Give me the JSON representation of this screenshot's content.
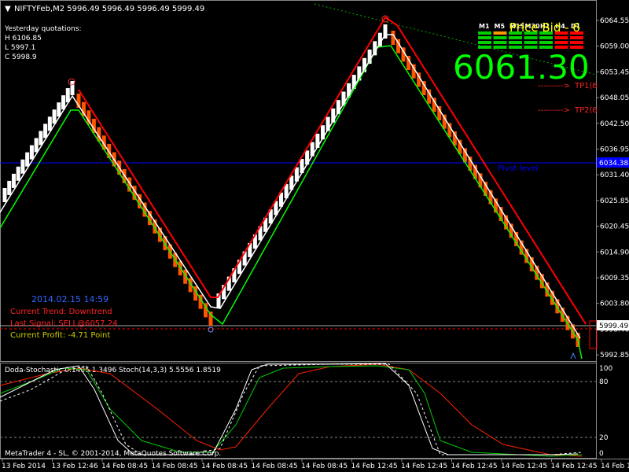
{
  "header": {
    "symbol_line": "NIFTYFeb,M2  5996.49 5996.49 5996.49 5999.49"
  },
  "yesterday": {
    "title": "Yesterday quotations:",
    "high": "H 6106.85",
    "low": "L 5997.1",
    "close": "C 5998.9"
  },
  "info": {
    "datetime": "2014.02.15 14:59",
    "trend": "Current Trend: Downtrend",
    "signal": "Last Signal: SELL@6057.24",
    "profit": "Current Profit: -4.71 Point"
  },
  "price_display": {
    "bid_label": "Price Bid - 6",
    "bid_value": "6061.30",
    "tp1": "TP1(6",
    "tp2": "TP2(6",
    "pivot_label": "Pivot level",
    "pivot_value": "6034.38"
  },
  "timeframes": [
    {
      "label": "M1",
      "bars": [
        "#00d000",
        "#00d000",
        "#00d000",
        "#00d000"
      ]
    },
    {
      "label": "M5",
      "bars": [
        "#ff9900",
        "#00d000",
        "#00d000",
        "#00d000"
      ]
    },
    {
      "label": "M15",
      "bars": [
        "#00d000",
        "#00d000",
        "#00d000",
        "#00d000"
      ]
    },
    {
      "label": "M30",
      "bars": [
        "#00d000",
        "#00d000",
        "#00d000",
        "#00d000"
      ]
    },
    {
      "label": "H1",
      "bars": [
        "#00d000",
        "#00d000",
        "#00d000",
        "#00d000"
      ]
    },
    {
      "label": "H4",
      "bars": [
        "#ff0000",
        "#ff0000",
        "#ff0000",
        "#ff0000"
      ]
    },
    {
      "label": "D1",
      "bars": [
        "#ff0000",
        "#ff0000",
        "#ff0000",
        "#ff0000"
      ]
    }
  ],
  "price_axis": {
    "ticks": [
      "6064.55",
      "6059.00",
      "6053.45",
      "6048.05",
      "6042.50",
      "6036.95",
      "6031.40",
      "6025.85",
      "6020.45",
      "6014.90",
      "6009.35",
      "6003.80",
      "5998.40",
      "5992.85"
    ],
    "current_price": "5999.49",
    "pivot_price": "6034.38"
  },
  "indicator": {
    "title": "Doda-Stochastic 0.1405 1.3496  Stoch(14,3,3) 5.5556 1.8519",
    "levels": [
      "100",
      "80",
      "20",
      "0"
    ],
    "copyright": "MetaTrader 4 - SL, © 2001-2014, MetaQuotes Software Corp."
  },
  "time_axis": {
    "labels": [
      "13 Feb 2014",
      "13 Feb 12:46",
      "14 Feb 08:45",
      "14 Feb 08:45",
      "14 Feb 08:45",
      "14 Feb 08:45",
      "14 Feb 08:45",
      "14 Feb 12:45",
      "14 Feb 12:45",
      "14 Feb 12:45",
      "14 Feb 12:45",
      "14 Feb 12:45",
      "14 Feb 12:45"
    ]
  },
  "colors": {
    "bull": "#ffffff",
    "bear": "#ff5500",
    "support": "#00ff00",
    "resistance": "#ff0000",
    "pivot": "#0000ff",
    "info_blue": "#3366ff",
    "info_red": "#ff2222",
    "profit": "#cccc00"
  }
}
